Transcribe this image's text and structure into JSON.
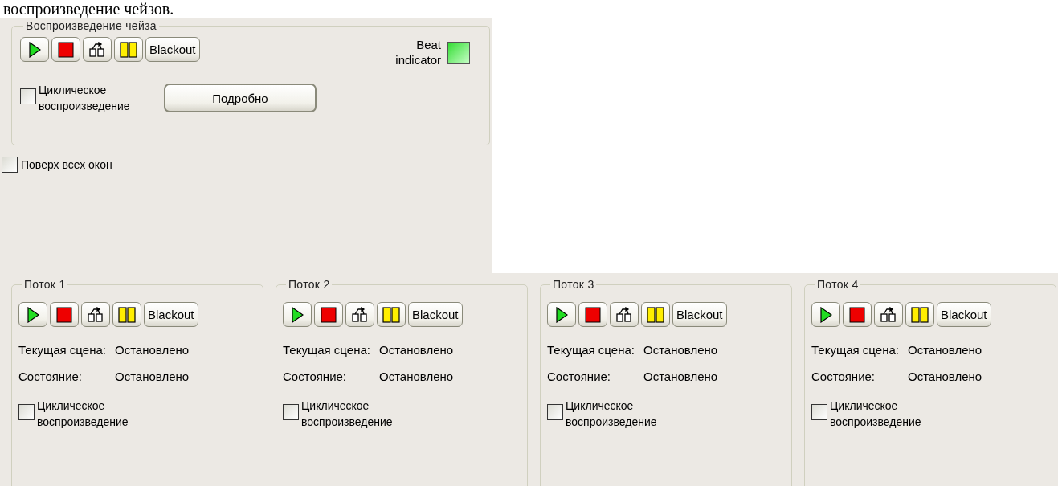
{
  "doc_text": "воспроизведение чейзов.",
  "chase_panel": {
    "title": "Воспроизведение чейза",
    "toolbar": [
      {
        "kind": "play"
      },
      {
        "kind": "stop"
      },
      {
        "kind": "reset"
      },
      {
        "kind": "pause"
      },
      {
        "kind": "text",
        "label": "Blackout"
      }
    ],
    "beat_indicator": {
      "label": "Beat indicator",
      "on": true
    },
    "loop": {
      "label": "Циклическое воспроизведение",
      "checked": false
    },
    "details_button": "Подробно"
  },
  "topmost": {
    "label": "Поверх всех окон",
    "checked": false
  },
  "streams": [
    {
      "title": "Поток 1",
      "toolbar": [
        {
          "kind": "play"
        },
        {
          "kind": "stop"
        },
        {
          "kind": "reset"
        },
        {
          "kind": "pause"
        },
        {
          "kind": "text",
          "label": "Blackout"
        }
      ],
      "current_scene_label": "Текущая сцена:",
      "current_scene": "Остановлено",
      "state_label": "Состояние:",
      "state": "Остановлено",
      "loop": {
        "label": "Циклическое воспроизведение",
        "checked": false
      }
    },
    {
      "title": "Поток 2",
      "toolbar": [
        {
          "kind": "play"
        },
        {
          "kind": "stop"
        },
        {
          "kind": "reset"
        },
        {
          "kind": "pause"
        },
        {
          "kind": "text",
          "label": "Blackout"
        }
      ],
      "current_scene_label": "Текущая сцена:",
      "current_scene": "Остановлено",
      "state_label": "Состояние:",
      "state": "Остановлено",
      "loop": {
        "label": "Циклическое воспроизведение",
        "checked": false
      }
    },
    {
      "title": "Поток 3",
      "toolbar": [
        {
          "kind": "play"
        },
        {
          "kind": "stop"
        },
        {
          "kind": "reset"
        },
        {
          "kind": "pause"
        },
        {
          "kind": "text",
          "label": "Blackout"
        }
      ],
      "current_scene_label": "Текущая сцена:",
      "current_scene": "Остановлено",
      "state_label": "Состояние:",
      "state": "Остановлено",
      "loop": {
        "label": "Циклическое воспроизведение",
        "checked": false
      }
    },
    {
      "title": "Поток 4",
      "toolbar": [
        {
          "kind": "play"
        },
        {
          "kind": "stop"
        },
        {
          "kind": "reset"
        },
        {
          "kind": "pause"
        },
        {
          "kind": "text",
          "label": "Blackout"
        }
      ],
      "current_scene_label": "Текущая сцена:",
      "current_scene": "Остановлено",
      "state_label": "Состояние:",
      "state": "Остановлено",
      "loop": {
        "label": "Циклическое воспроизведение",
        "checked": false
      }
    }
  ]
}
